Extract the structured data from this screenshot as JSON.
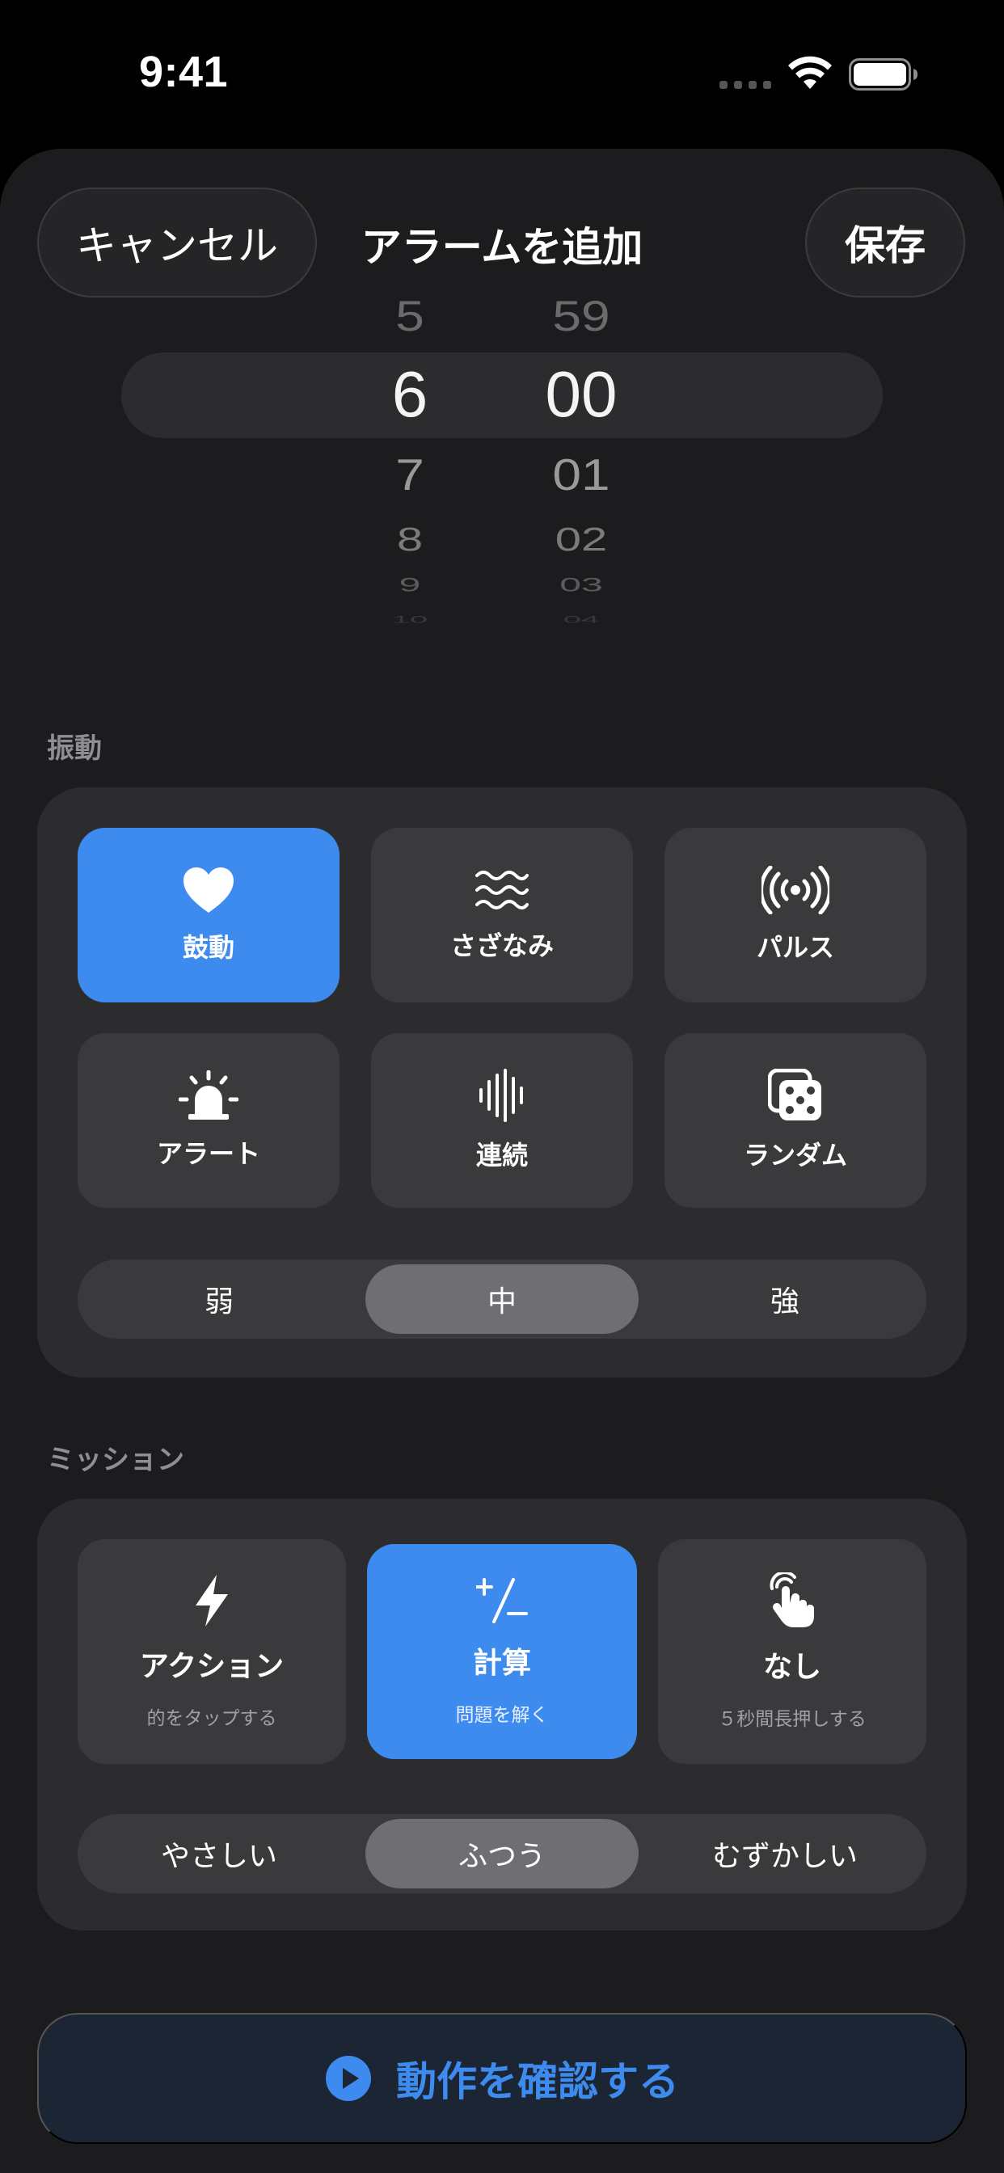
{
  "status_bar": {
    "time": "9:41"
  },
  "header": {
    "cancel_label": "キャンセル",
    "title": "アラームを追加",
    "save_label": "保存"
  },
  "time_picker": {
    "hours": [
      "5",
      "6",
      "7",
      "8",
      "9",
      "10"
    ],
    "minutes": [
      "59",
      "00",
      "01",
      "02",
      "03",
      "04"
    ],
    "selected_hour": "6",
    "selected_minute": "00"
  },
  "vibration": {
    "section_label": "振動",
    "patterns": [
      {
        "label": "鼓動",
        "icon": "heart-icon",
        "selected": true
      },
      {
        "label": "さざなみ",
        "icon": "waves-icon",
        "selected": false
      },
      {
        "label": "パルス",
        "icon": "radio-waves-icon",
        "selected": false
      },
      {
        "label": "アラート",
        "icon": "siren-icon",
        "selected": false
      },
      {
        "label": "連続",
        "icon": "waveform-icon",
        "selected": false
      },
      {
        "label": "ランダム",
        "icon": "dice-icon",
        "selected": false
      }
    ],
    "strength": {
      "options": [
        "弱",
        "中",
        "強"
      ],
      "selected": "中"
    }
  },
  "mission": {
    "section_label": "ミッション",
    "options": [
      {
        "label": "アクション",
        "description": "的をタップする",
        "icon": "bolt-icon",
        "selected": false
      },
      {
        "label": "計算",
        "description": "問題を解く",
        "icon": "plus-minus-icon",
        "selected": true
      },
      {
        "label": "なし",
        "description": "５秒間長押しする",
        "icon": "tap-hand-icon",
        "selected": false
      }
    ],
    "difficulty": {
      "options": [
        "やさしい",
        "ふつう",
        "むずかしい"
      ],
      "selected": "ふつう"
    }
  },
  "confirm_button": {
    "label": "動作を確認する",
    "icon": "play-circle-icon"
  },
  "colors": {
    "accent": "#3e8bf0",
    "background": "#000000",
    "sheet": "#1c1c1e",
    "card": "#2c2c2e",
    "tile": "#3a3a3c",
    "secondary_text": "#8e8e93"
  }
}
